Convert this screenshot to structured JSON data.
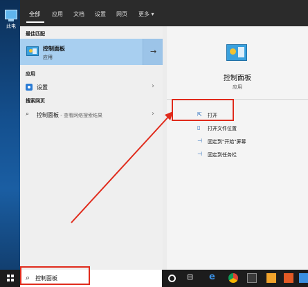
{
  "desktop": {
    "icon_label": "此电"
  },
  "tabs": [
    {
      "label": "全部"
    },
    {
      "label": "应用"
    },
    {
      "label": "文档"
    },
    {
      "label": "设置"
    },
    {
      "label": "网页"
    },
    {
      "label": "更多 ▾"
    }
  ],
  "left": {
    "best_match_heading": "最佳匹配",
    "best_match": {
      "title": "控制面板",
      "subtitle": "应用",
      "arrow": "→"
    },
    "apps_heading": "应用",
    "apps": [
      {
        "label": "设置",
        "chevron": "›"
      }
    ],
    "web_heading": "搜索网页",
    "web": [
      {
        "label": "控制面板",
        "hint": " - 查看网络搜索结果",
        "chevron": "›",
        "icon": "⌕"
      }
    ]
  },
  "right": {
    "title": "控制面板",
    "subtitle": "应用",
    "actions": [
      {
        "label": "打开",
        "icon": "⇱"
      },
      {
        "label": "打开文件位置",
        "icon": "▯"
      },
      {
        "label": "固定到\"开始\"屏幕",
        "icon": "⊣"
      },
      {
        "label": "固定到任务栏",
        "icon": "⊣"
      }
    ]
  },
  "taskbar": {
    "search_value": "控制面板",
    "search_icon": "⌕",
    "taskview_glyph": "⊟",
    "edge_glyph": "e"
  },
  "colors": {
    "highlight": "#e02b1c",
    "best_match_bg": "#a8cff0",
    "taskbar_bg": "#1c1c1c"
  }
}
